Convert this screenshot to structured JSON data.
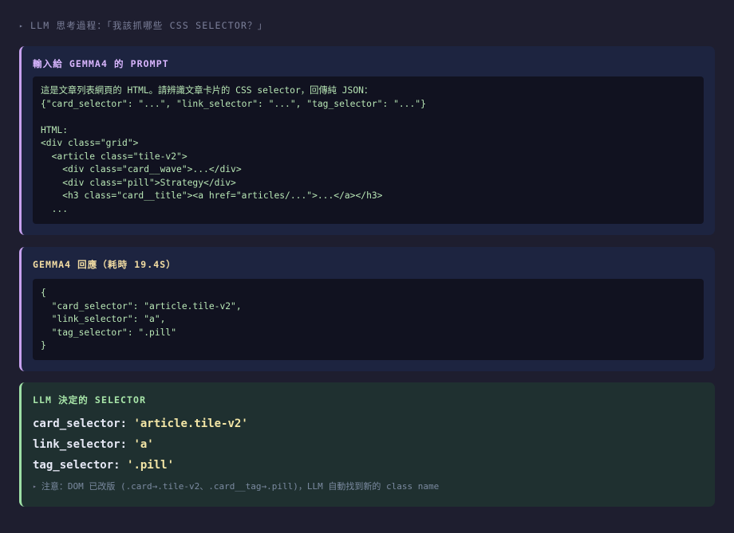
{
  "header": {
    "toggle_icon": "triangle-right-icon",
    "title": "LLM 思考過程：「我該抓哪些 CSS SELECTOR？」"
  },
  "prompt_panel": {
    "title": "輸入給 GEMMA4 的 PROMPT",
    "code": "這是文章列表網頁的 HTML。請辨識文章卡片的 CSS selector，回傳純 JSON：\n{\"card_selector\": \"...\", \"link_selector\": \"...\", \"tag_selector\": \"...\"}\n\nHTML:\n<div class=\"grid\">\n  <article class=\"tile-v2\">\n    <div class=\"card__wave\">...</div>\n    <div class=\"pill\">Strategy</div>\n    <h3 class=\"card__title\"><a href=\"articles/...\">...</a></h3>\n  ..."
  },
  "response_panel": {
    "title": "GEMMA4 回應（耗時 19.4S）",
    "code": "{\n  \"card_selector\": \"article.tile-v2\",\n  \"link_selector\": \"a\",\n  \"tag_selector\": \".pill\"\n}"
  },
  "decision_panel": {
    "title": "LLM 決定的 SELECTOR",
    "selectors": [
      {
        "key": "card_selector:",
        "value": "'article.tile-v2'"
      },
      {
        "key": "link_selector:",
        "value": "'a'"
      },
      {
        "key": "tag_selector:",
        "value": "'.pill'"
      }
    ],
    "note_icon": "triangle-right-icon",
    "note": "注意：DOM 已改版 (.card→.tile-v2、.card__tag→.pill)，LLM 自動找到新的 class name"
  },
  "colors": {
    "background": "#1e1e2f",
    "panel": "#1d2440",
    "success_panel": "#1f3030",
    "accent_purple": "#c8a2f0",
    "accent_green": "#9ee0a6",
    "code_text": "#b8e6b5"
  }
}
